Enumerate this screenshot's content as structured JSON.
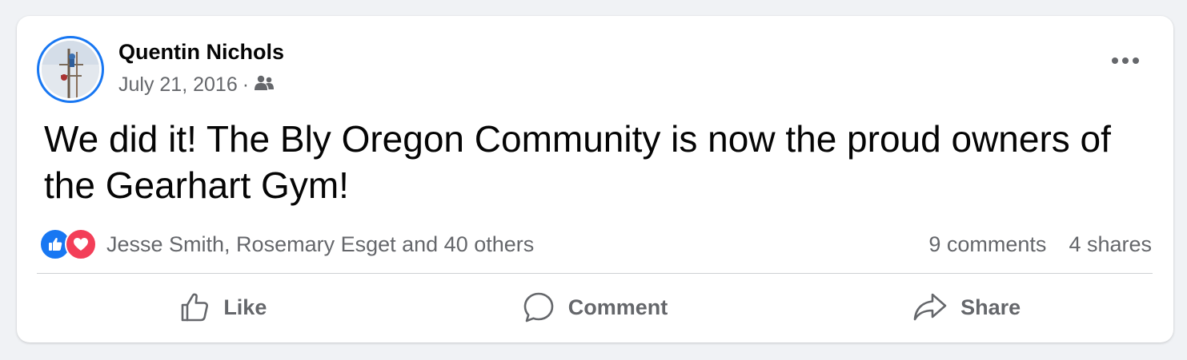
{
  "post": {
    "author": "Quentin Nichols",
    "date": "July 21, 2016",
    "separator": "·",
    "audience_icon": "friends-icon",
    "text": "We did it! The Bly Oregon Community is now the proud owners of the Gearhart Gym!"
  },
  "reactions": {
    "icons": [
      "like-reaction-icon",
      "love-reaction-icon"
    ],
    "summary": "Jesse Smith, Rosemary Esget and 40 others",
    "comments": "9 comments",
    "shares": "4 shares"
  },
  "actions": {
    "like": "Like",
    "comment": "Comment",
    "share": "Share"
  },
  "colors": {
    "accent": "#1877f2",
    "love": "#f33e58",
    "secondary_text": "#65676b",
    "background": "#f0f2f5"
  }
}
